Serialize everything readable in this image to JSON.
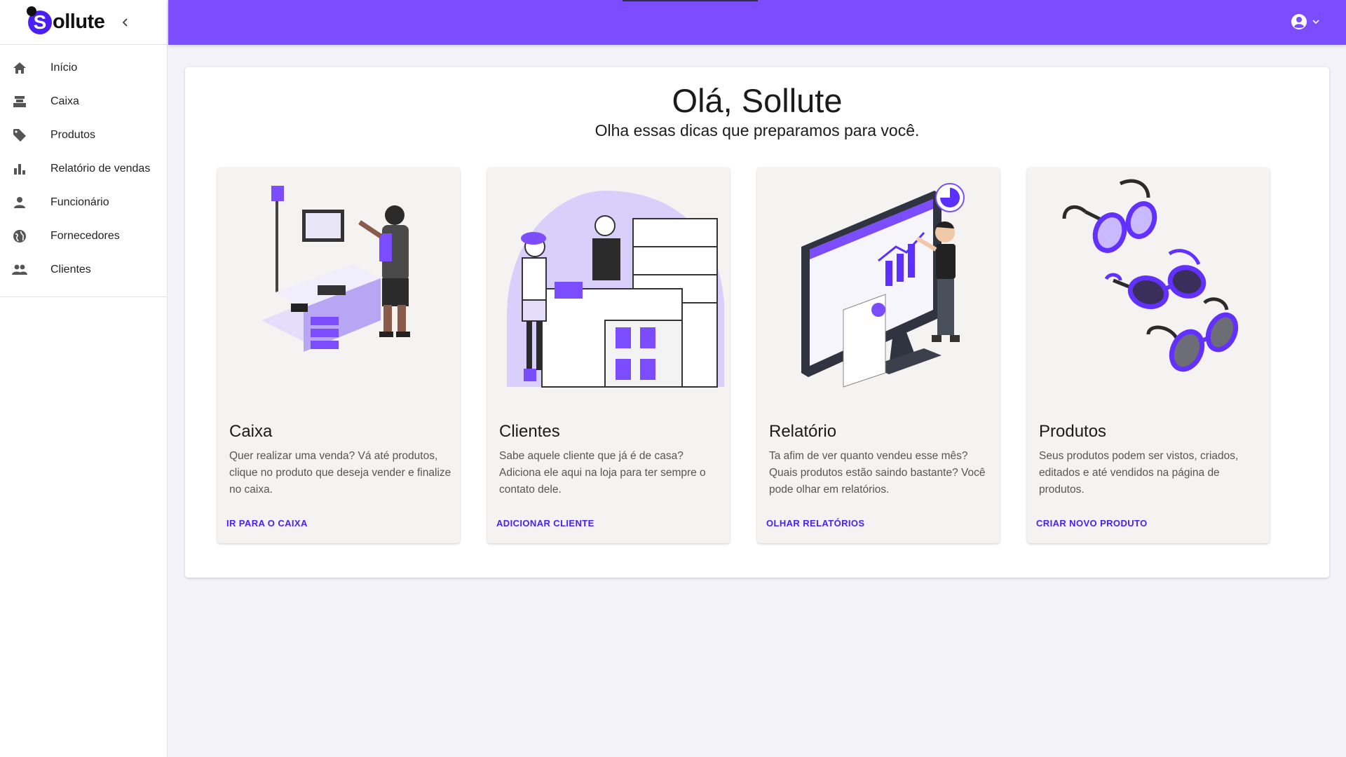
{
  "brand": {
    "s": "S",
    "name": "ollute"
  },
  "sidebar": {
    "items": [
      {
        "label": "Início",
        "icon": "home-icon"
      },
      {
        "label": "Caixa",
        "icon": "cash-register-icon"
      },
      {
        "label": "Produtos",
        "icon": "tag-icon"
      },
      {
        "label": "Relatório de vendas",
        "icon": "bar-chart-icon"
      },
      {
        "label": "Funcionário",
        "icon": "person-icon"
      },
      {
        "label": "Fornecedores",
        "icon": "globe-icon"
      },
      {
        "label": "Clientes",
        "icon": "people-icon"
      }
    ]
  },
  "header": {
    "accent": "#7b4dff",
    "user_icon": "account-circle-icon",
    "caret_icon": "chevron-down-icon"
  },
  "main": {
    "greeting": "Olá, Sollute",
    "subtitle": "Olha essas dicas que preparamos para você.",
    "tips": [
      {
        "title": "Caixa",
        "body": "Quer realizar uma venda? Vá até produtos, clique no produto que deseja vender e finalize no caixa.",
        "action": "IR PARA O CAIXA"
      },
      {
        "title": "Clientes",
        "body": "Sabe aquele cliente que já é de casa? Adiciona ele aqui na loja para ter sempre o contato dele.",
        "action": "ADICIONAR CLIENTE"
      },
      {
        "title": "Relatório",
        "body": "Ta afim de ver quanto vendeu esse mês? Quais produtos estão saindo bastante? Você pode olhar em relatórios.",
        "action": "OLHAR RELATÓRIOS"
      },
      {
        "title": "Produtos",
        "body": "Seus produtos podem ser vistos, criados, editados e até vendidos na página de produtos.",
        "action": "CRIAR NOVO PRODUTO"
      }
    ]
  },
  "colors": {
    "brand": "#4a1ff5",
    "accent": "#7b4dff",
    "card": "#f5f3f2"
  }
}
